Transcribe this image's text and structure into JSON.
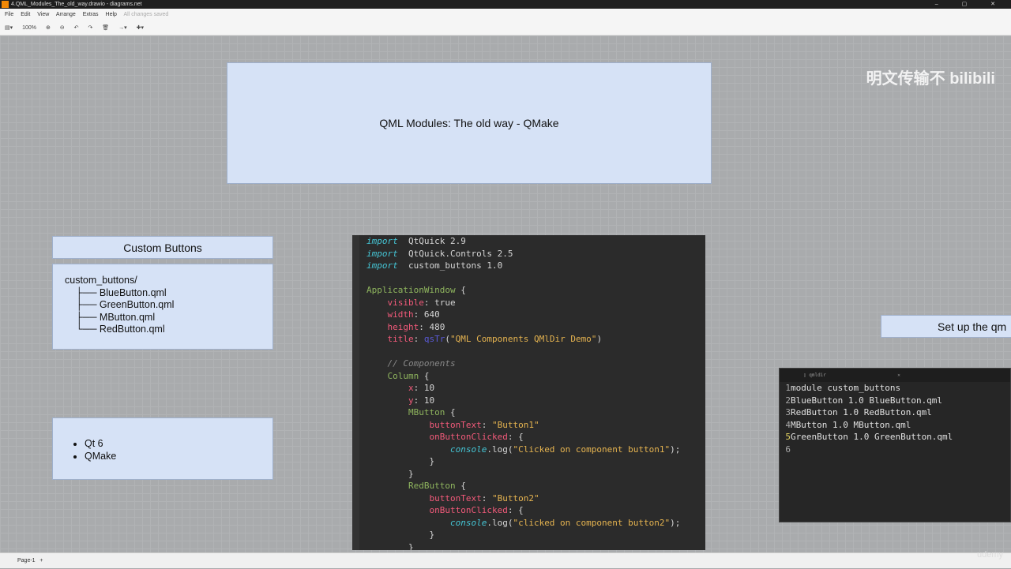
{
  "window": {
    "title": "4.QML_Modules_The_old_way.drawio - diagrams.net",
    "controls": "– ▢ ✕"
  },
  "menu": [
    "File",
    "Edit",
    "View",
    "Arrange",
    "Extras",
    "Help"
  ],
  "menu_status": "All changes saved",
  "toolbar": {
    "zoom": "100%",
    "items": [
      "▤▾",
      "⊕",
      "⊖",
      "↶",
      "↷",
      "🗑",
      "→▾",
      "✚▾"
    ]
  },
  "diagram": {
    "title": "QML Modules: The old way - QMake",
    "custom_buttons_header": "Custom Buttons",
    "tree": [
      "custom_buttons/",
      "    ├── BlueButton.qml",
      "    ├── GreenButton.qml",
      "    ├── MButton.qml",
      "    └── RedButton.qml"
    ],
    "bullets": [
      "Qt 6",
      "QMake"
    ],
    "setup_label": "Set up the qm"
  },
  "code_lines": [
    [
      [
        "kw",
        "import"
      ],
      [
        "",
        "  QtQuick 2.9"
      ]
    ],
    [
      [
        "kw",
        "import"
      ],
      [
        "",
        "  QtQuick.Controls 2.5"
      ]
    ],
    [
      [
        "kw",
        "import"
      ],
      [
        "",
        "  custom_buttons 1.0"
      ]
    ],
    [],
    [
      [
        "ty",
        "ApplicationWindow"
      ],
      [
        "",
        " {"
      ]
    ],
    [
      [
        "",
        "    "
      ],
      [
        "pr",
        "visible"
      ],
      [
        "",
        ": true"
      ]
    ],
    [
      [
        "",
        "    "
      ],
      [
        "pr",
        "width"
      ],
      [
        "",
        ": 640"
      ]
    ],
    [
      [
        "",
        "    "
      ],
      [
        "pr",
        "height"
      ],
      [
        "",
        ": 480"
      ]
    ],
    [
      [
        "",
        "    "
      ],
      [
        "pr",
        "title"
      ],
      [
        "",
        ": "
      ],
      [
        "fn",
        "qsTr"
      ],
      [
        "",
        "("
      ],
      [
        "st",
        "\"QML Components QMlDir Demo\""
      ],
      [
        "",
        ")"
      ]
    ],
    [],
    [
      [
        "",
        "    "
      ],
      [
        "cm",
        "// Components"
      ]
    ],
    [
      [
        "",
        "    "
      ],
      [
        "ty",
        "Column"
      ],
      [
        "",
        " {"
      ]
    ],
    [
      [
        "",
        "        "
      ],
      [
        "pr",
        "x"
      ],
      [
        "",
        ": 10"
      ]
    ],
    [
      [
        "",
        "        "
      ],
      [
        "pr",
        "y"
      ],
      [
        "",
        ": 10"
      ]
    ],
    [
      [
        "",
        "        "
      ],
      [
        "ty",
        "MButton"
      ],
      [
        "",
        " {"
      ]
    ],
    [
      [
        "",
        "            "
      ],
      [
        "pr",
        "buttonText"
      ],
      [
        "",
        ": "
      ],
      [
        "st",
        "\"Button1\""
      ]
    ],
    [
      [
        "",
        "            "
      ],
      [
        "pr",
        "onButtonClicked"
      ],
      [
        "",
        ": {"
      ]
    ],
    [
      [
        "",
        "                "
      ],
      [
        "cn",
        "console"
      ],
      [
        "",
        ".log("
      ],
      [
        "st",
        "\"Clicked on component button1\""
      ],
      [
        "",
        ");"
      ]
    ],
    [
      [
        "",
        "            }"
      ]
    ],
    [
      [
        "",
        "        }"
      ]
    ],
    [
      [
        "",
        "        "
      ],
      [
        "ty",
        "RedButton"
      ],
      [
        "",
        " {"
      ]
    ],
    [
      [
        "",
        "            "
      ],
      [
        "pr",
        "buttonText"
      ],
      [
        "",
        ": "
      ],
      [
        "st",
        "\"Button2\""
      ]
    ],
    [
      [
        "",
        "            "
      ],
      [
        "pr",
        "onButtonClicked"
      ],
      [
        "",
        ": {"
      ]
    ],
    [
      [
        "",
        "                "
      ],
      [
        "cn",
        "console"
      ],
      [
        "",
        ".log("
      ],
      [
        "st",
        "\"clicked on component button2\""
      ],
      [
        "",
        ");"
      ]
    ],
    [
      [
        "",
        "            }"
      ]
    ],
    [
      [
        "",
        "        }"
      ]
    ]
  ],
  "qmldir": {
    "tab": "qmldir",
    "lines": [
      "module custom_buttons",
      "BlueButton 1.0 BlueButton.qml",
      "RedButton 1.0 RedButton.qml",
      "MButton 1.0 MButton.qml",
      "GreenButton 1.0 GreenButton.qml",
      ""
    ]
  },
  "watermark": "明文传输不 bilibili",
  "page_tab": "Page-1",
  "udemy": "udemy"
}
